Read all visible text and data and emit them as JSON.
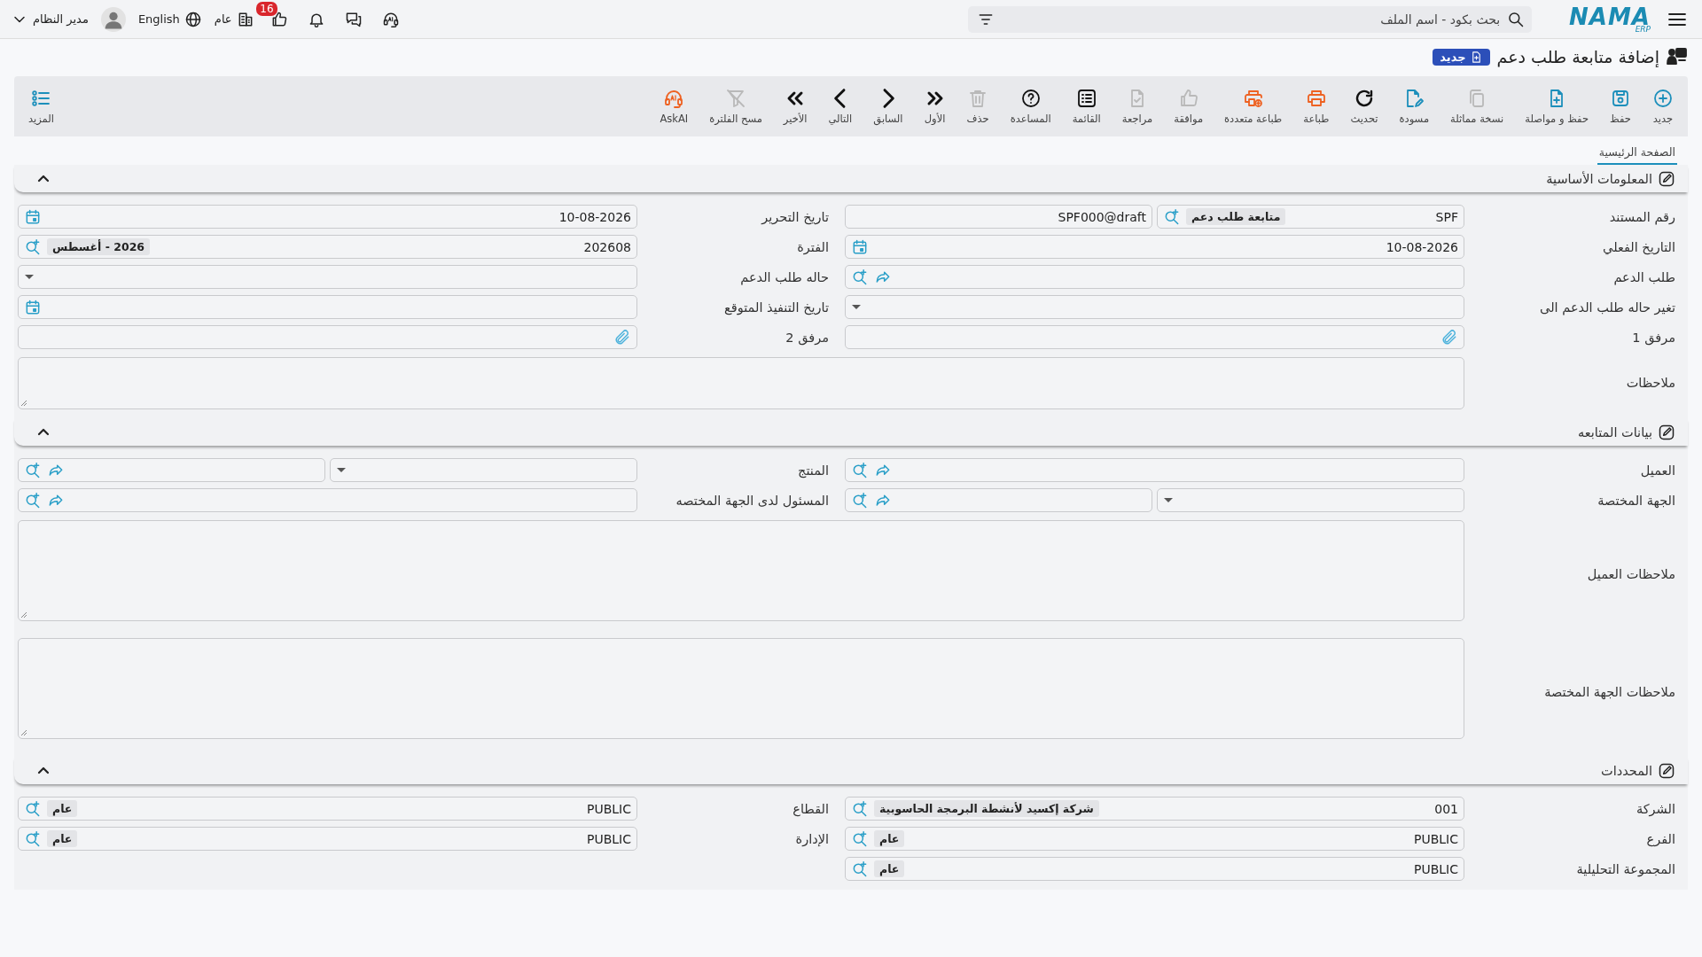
{
  "top_bar": {
    "logo": {
      "name": "NAMA",
      "sub": "ERP"
    },
    "search": {
      "placeholder": "بحث بكود - اسم الملف"
    },
    "user": "مدير النظام",
    "language": "English",
    "company": "عام",
    "likes_badge": "16"
  },
  "page": {
    "title": "إضافة متابعة طلب دعم",
    "status_badge": "جديد"
  },
  "toolbar": [
    {
      "label": "جديد",
      "kind": "new",
      "color": "#1c8fbb",
      "disabled": false
    },
    {
      "label": "حفظ",
      "kind": "save",
      "color": "#1c8fbb",
      "disabled": false
    },
    {
      "label": "حفظ و مواصلة",
      "kind": "save-continue",
      "color": "#1c8fbb",
      "disabled": false
    },
    {
      "label": "نسخة مماثلة",
      "kind": "duplicate",
      "disabled": true
    },
    {
      "label": "مسودة",
      "kind": "draft",
      "color": "#1c8fbb",
      "disabled": false
    },
    {
      "label": "تحديث",
      "kind": "refresh",
      "color": "#111111",
      "disabled": false
    },
    {
      "label": "طباعة",
      "kind": "print",
      "color": "#ee6121",
      "disabled": false
    },
    {
      "label": "طباعة متعددة",
      "kind": "multi-print",
      "color": "#ee6121",
      "disabled": false
    },
    {
      "label": "موافقة",
      "kind": "approve",
      "disabled": true
    },
    {
      "label": "مراجعة",
      "kind": "review",
      "disabled": true
    },
    {
      "label": "القائمة",
      "kind": "list",
      "color": "#111111",
      "disabled": false
    },
    {
      "label": "المساعدة",
      "kind": "help",
      "color": "#111111",
      "disabled": false
    },
    {
      "label": "حذف",
      "kind": "delete",
      "disabled": true
    },
    {
      "label": "الأول",
      "kind": "first",
      "color": "#111111",
      "disabled": false
    },
    {
      "label": "السابق",
      "kind": "previous",
      "color": "#111111",
      "disabled": false
    },
    {
      "label": "التالي",
      "kind": "next",
      "color": "#111111",
      "disabled": false
    },
    {
      "label": "الأخير",
      "kind": "last",
      "color": "#111111",
      "disabled": false
    },
    {
      "label": "مسح الفلترة",
      "kind": "clear-filter",
      "disabled": true
    },
    {
      "label": "AskAI",
      "kind": "ask-ai",
      "color": "#ee6121",
      "disabled": false
    }
  ],
  "more": "المزيد",
  "tabs": [
    {
      "label": "الصفحة الرئيسية",
      "selected": true
    }
  ],
  "sections": [
    {
      "title": "المعلومات الأساسية",
      "expanded": true,
      "rows": [
        [
          {
            "label": "رقم المستند",
            "kind": "doc_number",
            "value": "SPF",
            "tag": "متابعة طلب دعم",
            "value2": "SPF000@draft"
          },
          {
            "label": "تاريخ التحرير",
            "kind": "date",
            "value": "10-08-2026"
          }
        ],
        [
          {
            "label": "التاريخ الفعلي",
            "kind": "date",
            "value": "10-08-2026"
          },
          {
            "label": "الفترة",
            "kind": "lookup",
            "value": "202608",
            "tag": "2026 - أغسطس"
          }
        ],
        [
          {
            "label": "طلب الدعم",
            "kind": "lookup_link"
          },
          {
            "label": "حاله طلب الدعم",
            "kind": "select"
          }
        ],
        [
          {
            "label": "تغير حاله طلب الدعم الى",
            "kind": "select"
          },
          {
            "label": "تاريخ التنفيذ المتوقع",
            "kind": "date"
          }
        ],
        [
          {
            "label": "مرفق 1",
            "kind": "attach"
          },
          {
            "label": "مرفق 2",
            "kind": "attach"
          }
        ],
        [
          {
            "label": "ملاحظات",
            "kind": "textarea"
          }
        ]
      ]
    },
    {
      "title": "بيانات المتابعه",
      "expanded": true,
      "rows": [
        [
          {
            "label": "العميل",
            "kind": "lookup_link"
          },
          {
            "label": "المنتج",
            "kind": "select_lookup"
          }
        ],
        [
          {
            "label": "الجهة المختصة",
            "kind": "select_lookup"
          },
          {
            "label": "المسئول لدى الجهة المختصه",
            "kind": "lookup_link"
          }
        ],
        [
          {
            "label": "ملاحظات العميل",
            "kind": "textarea_tall"
          }
        ],
        [
          {
            "label": "ملاحظات الجهة المختصة",
            "kind": "textarea_tall"
          }
        ]
      ]
    },
    {
      "title": "المحددات",
      "expanded": true,
      "rows": [
        [
          {
            "label": "الشركة",
            "kind": "lookup",
            "value": "001",
            "tag": "شركة إكسيد لأنشطة البرمجة الحاسوبية"
          },
          {
            "label": "القطاع",
            "kind": "lookup",
            "value": "PUBLIC",
            "tag": "عام"
          }
        ],
        [
          {
            "label": "الفرع",
            "kind": "lookup",
            "value": "PUBLIC",
            "tag": "عام"
          },
          {
            "label": "الإدارة",
            "kind": "lookup",
            "value": "PUBLIC",
            "tag": "عام"
          }
        ],
        [
          {
            "label": "المجموعة التحليلية",
            "kind": "lookup",
            "value": "PUBLIC",
            "tag": "عام"
          }
        ]
      ]
    }
  ]
}
